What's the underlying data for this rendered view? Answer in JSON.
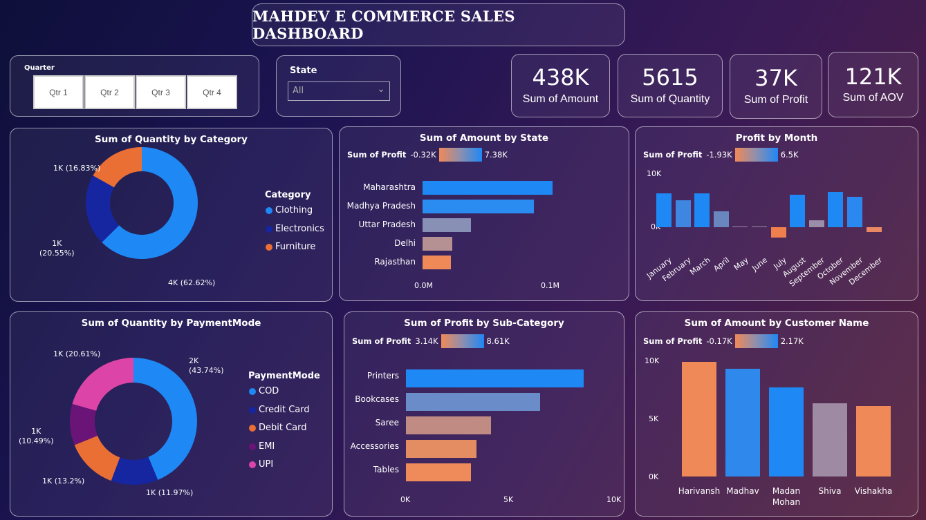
{
  "title": "MAHDEV E COMMERCE SALES DASHBOARD",
  "quarter_slicer": {
    "label": "Quarter",
    "options": [
      "Qtr 1",
      "Qtr 2",
      "Qtr 3",
      "Qtr 4"
    ]
  },
  "state_slicer": {
    "label": "State",
    "value": "All"
  },
  "kpis": [
    {
      "value": "438K",
      "label": "Sum of Amount"
    },
    {
      "value": "5615",
      "label": "Sum of Quantity"
    },
    {
      "value": "37K",
      "label": "Sum of Profit"
    },
    {
      "value": "121K",
      "label": "Sum of AOV"
    }
  ],
  "chart_data": [
    {
      "type": "pie",
      "title": "Sum of Quantity by Category",
      "legend_title": "Category",
      "categories": [
        "Clothing",
        "Electronics",
        "Furniture"
      ],
      "values": [
        62.62,
        20.55,
        16.83
      ],
      "labels": [
        "4K (62.62%)",
        "1K\n(20.55%)",
        "1K (16.83%)"
      ],
      "colors": [
        "#1e88f5",
        "#1526a0",
        "#ea6f34"
      ]
    },
    {
      "type": "bar",
      "title": "Sum of Amount by State",
      "color_legend": {
        "label": "Sum of Profit",
        "min": "-0.32K",
        "max": "7.38K"
      },
      "categories": [
        "Maharashtra",
        "Madhya Pradesh",
        "Uttar Pradesh",
        "Delhi",
        "Rajasthan"
      ],
      "values": [
        0.105,
        0.09,
        0.039,
        0.024,
        0.023
      ],
      "colors": [
        "#1e88f5",
        "#2a8bf0",
        "#8890b6",
        "#b59193",
        "#ef8a58"
      ],
      "x_ticks": [
        "0.0M",
        "0.1M"
      ],
      "xlim": [
        0,
        0.105
      ]
    },
    {
      "type": "bar",
      "title": "Profit by Month",
      "color_legend": {
        "label": "Sum of Profit",
        "min": "-1.93K",
        "max": "6.5K"
      },
      "categories": [
        "January",
        "February",
        "March",
        "April",
        "May",
        "June",
        "July",
        "August",
        "September",
        "October",
        "November",
        "December"
      ],
      "values": [
        6.2,
        5.0,
        6.2,
        2.9,
        0.1,
        0.1,
        -1.9,
        6.0,
        1.3,
        6.5,
        5.6,
        -0.9
      ],
      "colors": [
        "#1e88f5",
        "#3f86e0",
        "#1e88f5",
        "#6a86bf",
        "#9a8da8",
        "#9a8da8",
        "#ef7f4c",
        "#1e88f5",
        "#9a8ea9",
        "#1e88f5",
        "#2a88f0",
        "#e98a64"
      ],
      "y_ticks": [
        "10K",
        "0K"
      ],
      "ylim": [
        -2,
        10
      ]
    },
    {
      "type": "pie",
      "title": "Sum of Quantity by PaymentMode",
      "legend_title": "PaymentMode",
      "categories": [
        "COD",
        "Credit Card",
        "Debit Card",
        "EMI",
        "UPI"
      ],
      "values": [
        43.74,
        11.97,
        13.2,
        10.49,
        20.61
      ],
      "labels": [
        "2K\n(43.74%)",
        "1K (11.97%)",
        "1K (13.2%)",
        "1K\n(10.49%)",
        "1K (20.61%)"
      ],
      "colors": [
        "#1e88f5",
        "#1526a0",
        "#ea6f34",
        "#6a1478",
        "#dc45a7"
      ]
    },
    {
      "type": "bar",
      "title": "Sum of Profit by Sub-Category",
      "color_legend": {
        "label": "Sum of Profit",
        "min": "3.14K",
        "max": "8.61K"
      },
      "categories": [
        "Printers",
        "Bookcases",
        "Saree",
        "Accessories",
        "Tables"
      ],
      "values": [
        8.61,
        6.5,
        4.1,
        3.4,
        3.14
      ],
      "colors": [
        "#1e88f5",
        "#6a8cc8",
        "#c08b82",
        "#e48d63",
        "#ef8a5a"
      ],
      "x_ticks": [
        "0K",
        "5K",
        "10K"
      ],
      "xlim": [
        0,
        10
      ]
    },
    {
      "type": "bar",
      "title": "Sum of Amount by Customer Name",
      "color_legend": {
        "label": "Sum of Profit",
        "min": "-0.17K",
        "max": "2.17K"
      },
      "categories": [
        "Harivansh",
        "Madhav",
        "Madan\nMohan",
        "Shiva",
        "Vishakha"
      ],
      "values": [
        9.9,
        9.3,
        7.7,
        6.3,
        6.1
      ],
      "colors": [
        "#ef8a58",
        "#2f88ec",
        "#1e88f5",
        "#9e8ba3",
        "#ef8a58"
      ],
      "y_ticks": [
        "10K",
        "5K",
        "0K"
      ],
      "ylim": [
        0,
        10
      ]
    }
  ]
}
